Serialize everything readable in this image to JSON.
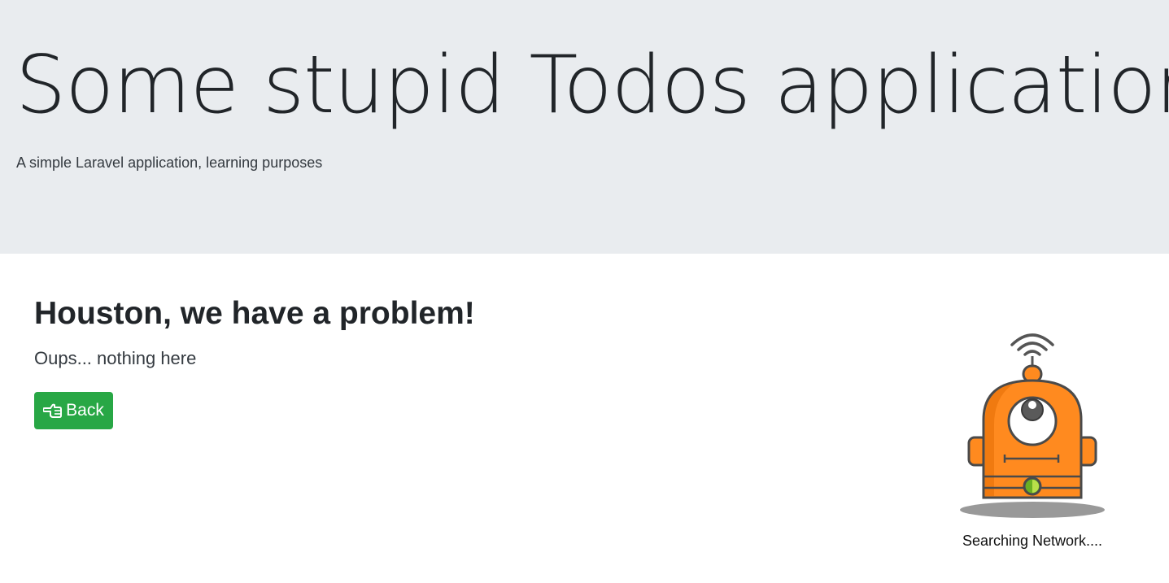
{
  "header": {
    "title": "Some stupid Todos application",
    "lead": "A simple Laravel application, learning purposes"
  },
  "error": {
    "title": "Houston, we have a problem!",
    "message": "Oups... nothing here",
    "back_label": "Back",
    "back_icon": "hand-point-left-icon"
  },
  "illustration": {
    "name": "robot-searching-illustration",
    "caption": "Searching Network....",
    "colors": {
      "body": "#ff8a1f",
      "outline": "#4a4a4a",
      "shadow": "#999999",
      "indicator": "#6ab023"
    }
  },
  "theme": {
    "jumbotron_bg": "#e9ecef",
    "button_success": "#28a745"
  }
}
